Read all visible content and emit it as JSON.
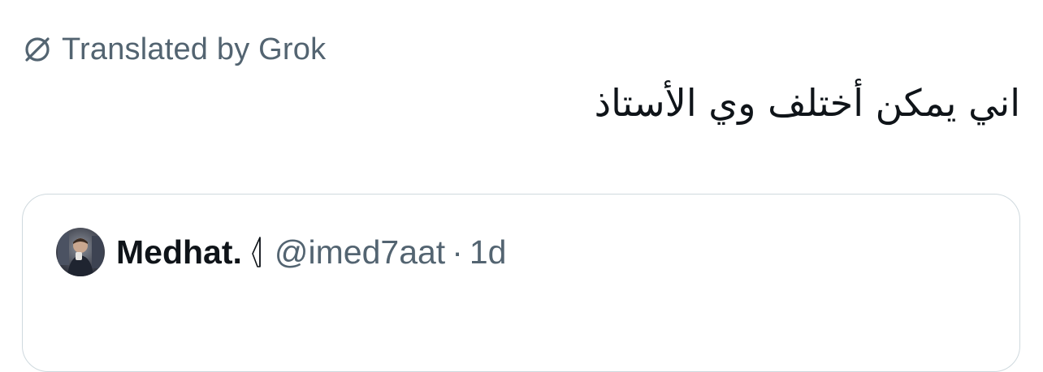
{
  "translation": {
    "icon": "translate-slash-icon",
    "label": "Translated by Grok"
  },
  "tweet": {
    "text": "اني يمكن أختلف وي الأستاذ"
  },
  "quote": {
    "avatar_icon": "user-avatar",
    "author_name": "Medhat.",
    "badge_icon": "flag-icon",
    "handle": "@imed7aat",
    "separator": "·",
    "time": "1d"
  },
  "colors": {
    "text_primary": "#0f1419",
    "text_secondary": "#536471",
    "border": "#cfd9de"
  }
}
